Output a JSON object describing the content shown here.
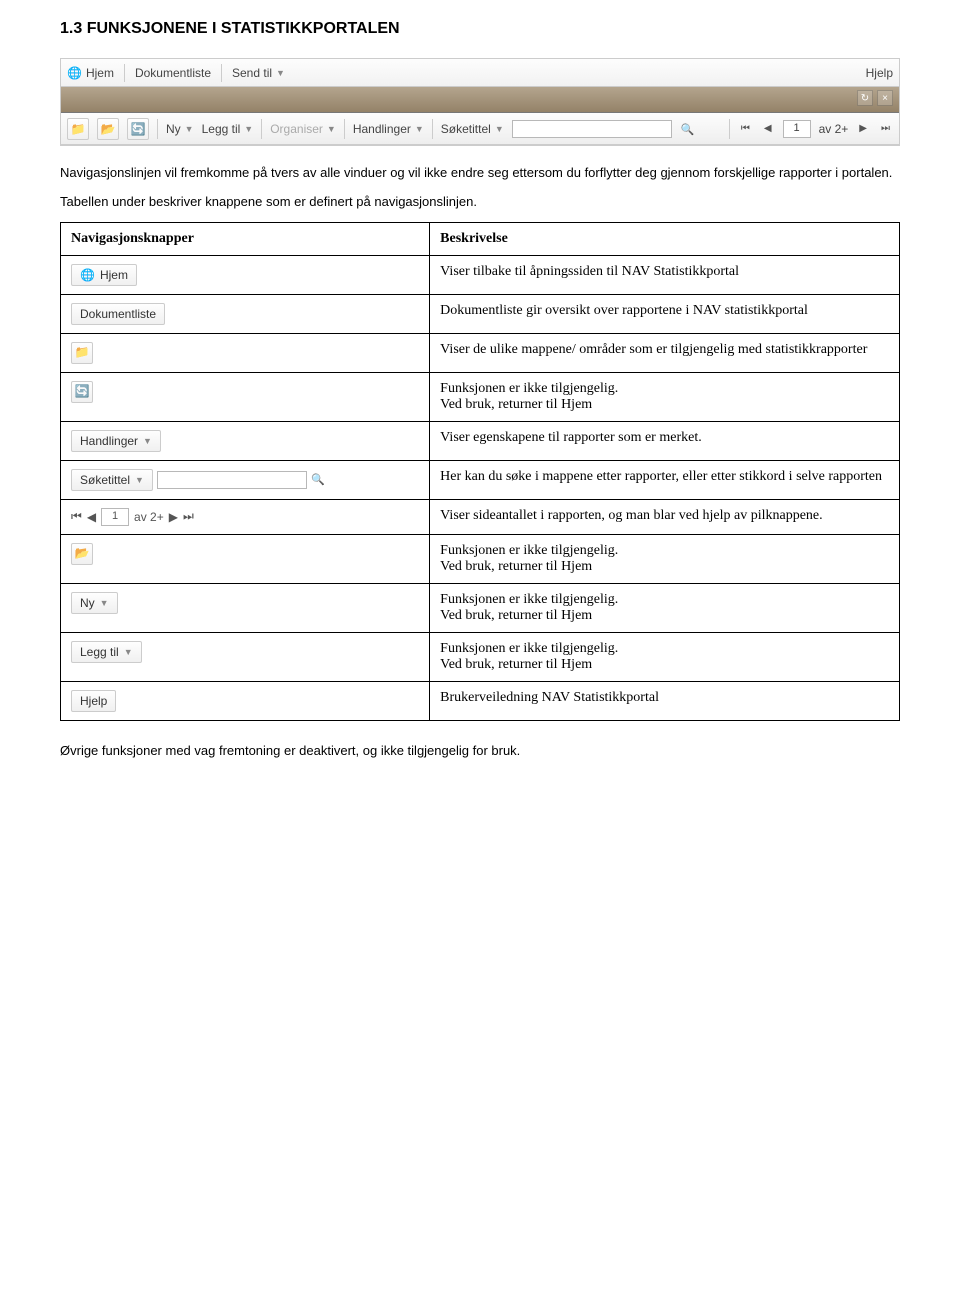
{
  "heading": "1.3    FUNKSJONENE I STATISTIKKPORTALEN",
  "toolbar": {
    "top": {
      "hjem": "Hjem",
      "dokumentliste": "Dokumentliste",
      "send_til": "Send til",
      "hjelp": "Hjelp"
    },
    "bottom": {
      "ny": "Ny",
      "legg_til": "Legg til",
      "organiser": "Organiser",
      "handlinger": "Handlinger",
      "soketittel": "Søketittel",
      "page_value": "1",
      "av_label": "av 2+"
    }
  },
  "para1": "Navigasjonslinjen vil fremkomme på tvers av alle vinduer og vil ikke endre seg ettersom du forflytter deg gjennom forskjellige rapporter i portalen.",
  "para2": "Tabellen under beskriver knappene som er definert på navigasjonslinjen.",
  "table": {
    "header_left": "Navigasjonsknapper",
    "header_right": "Beskrivelse",
    "rows": [
      {
        "btn_label": "Hjem",
        "desc": "Viser tilbake til åpningssiden til NAV Statistikkportal"
      },
      {
        "btn_label": "Dokumentliste",
        "desc": "Dokumentliste gir oversikt over rapportene i NAV statistikkportal"
      },
      {
        "btn_label": "",
        "desc": "Viser de ulike mappene/ områder som er tilgjengelig med statistikkrapporter"
      },
      {
        "btn_label": "",
        "desc": "Funksjonen er ikke tilgjengelig.\nVed bruk, returner til Hjem"
      },
      {
        "btn_label": "Handlinger",
        "desc": "Viser egenskapene til rapporter som er merket."
      },
      {
        "btn_label": "Søketittel",
        "desc": "Her kan du søke i mappene etter rapporter, eller etter stikkord i selve rapporten"
      },
      {
        "btn_label_page": "1",
        "btn_label_av": "av 2+",
        "desc": "Viser sideantallet i rapporten, og man blar ved hjelp av pilknappene."
      },
      {
        "btn_label": "",
        "desc": "Funksjonen er ikke tilgjengelig.\nVed bruk, returner til Hjem"
      },
      {
        "btn_label": "Ny",
        "desc": "Funksjonen er ikke tilgjengelig.\nVed bruk, returner til Hjem"
      },
      {
        "btn_label": "Legg til",
        "desc": "Funksjonen er ikke tilgjengelig.\nVed bruk, returner til Hjem"
      },
      {
        "btn_label": "Hjelp",
        "desc": "Brukerveiledning NAV Statistikkportal"
      }
    ]
  },
  "footer": "Øvrige funksjoner med vag fremtoning er deaktivert, og ikke tilgjengelig for bruk."
}
